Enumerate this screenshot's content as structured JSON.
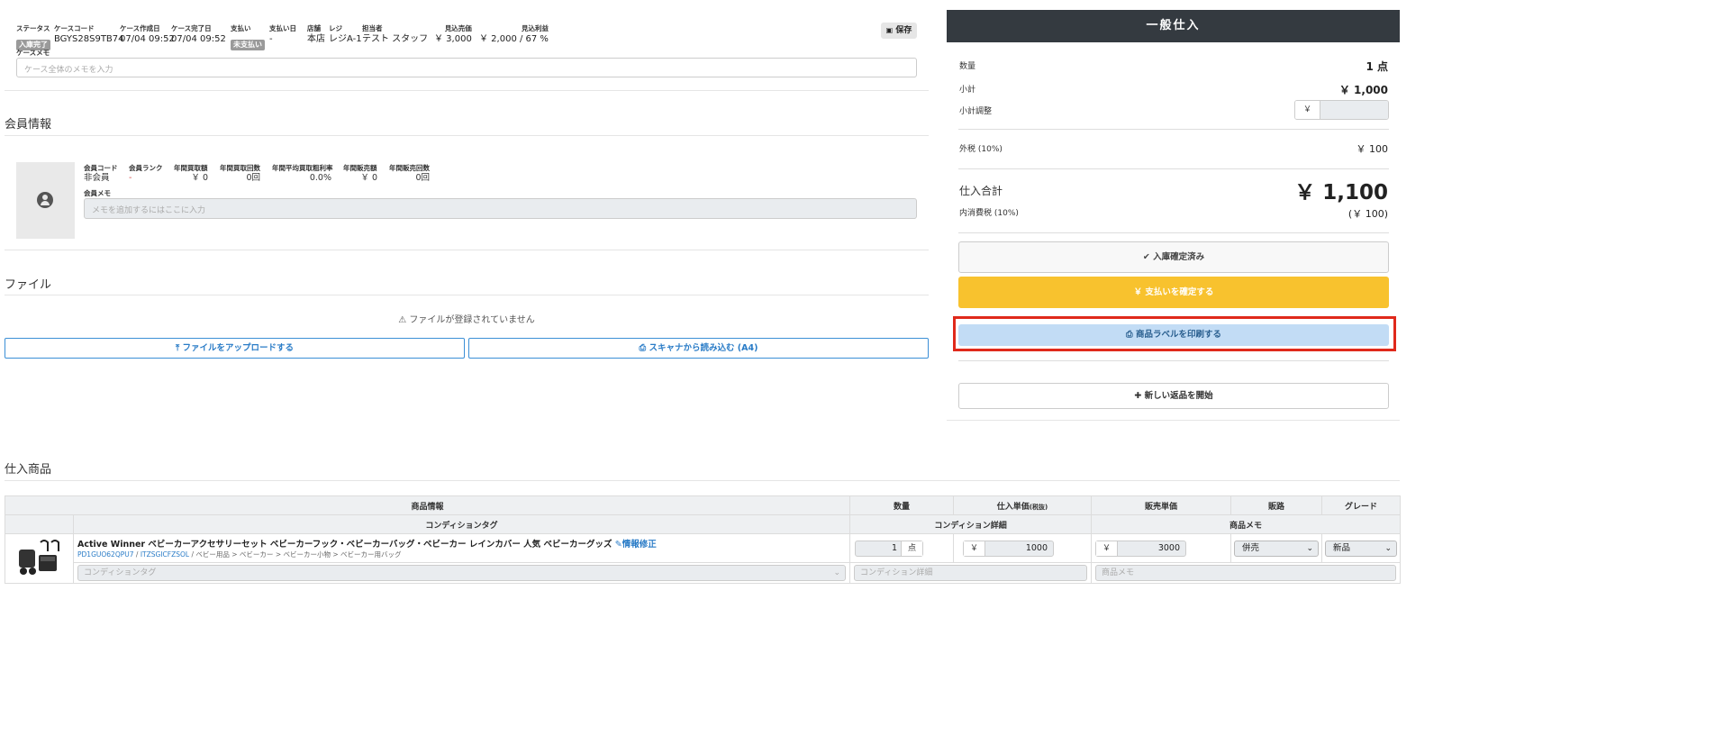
{
  "case": {
    "labels": {
      "status": "ステータス",
      "case_code": "ケースコード",
      "created": "ケース作成日",
      "completed": "ケース完了日",
      "payment": "支払い",
      "payment_date": "支払い日",
      "store": "店舗",
      "register": "レジ",
      "staff": "担当者",
      "expected_sales": "見込売価",
      "expected_profit": "見込利益"
    },
    "values": {
      "status": "入庫完了",
      "case_code": "BGYS28S9TB74",
      "created": "07/04 09:52",
      "completed": "07/04 09:52",
      "payment": "未支払い",
      "payment_date": "-",
      "store": "本店",
      "register": "レジA-1",
      "staff": "テスト スタッフ",
      "expected_sales": "￥ 3,000",
      "expected_profit": "￥ 2,000 / 67 %"
    },
    "save_label": "保存",
    "memo_label": "ケースメモ",
    "memo_placeholder": "ケース全体のメモを入力"
  },
  "member": {
    "section_title": "会員情報",
    "labels": {
      "code": "会員コード",
      "rank": "会員ランク",
      "annual_purchase_amount": "年間買取額",
      "annual_purchase_count": "年間買取回数",
      "avg_margin": "年間平均買取粗利率",
      "annual_sales_amount": "年間販売額",
      "annual_sales_count": "年間販売回数"
    },
    "values": {
      "code": "非会員",
      "rank": "-",
      "annual_purchase_amount": "￥ 0",
      "annual_purchase_count": "0回",
      "avg_margin": "0.0%",
      "annual_sales_amount": "￥ 0",
      "annual_sales_count": "0回"
    },
    "memo_label": "会員メモ",
    "memo_placeholder": "メモを追加するにはここに入力"
  },
  "files": {
    "section_title": "ファイル",
    "empty_message": "ファイルが登録されていません",
    "upload_label": "ファイルをアップロードする",
    "scan_label": "スキャナから読み込む (A4)"
  },
  "summary": {
    "title": "一般仕入",
    "quantity_label": "数量",
    "quantity_value": "1 点",
    "subtotal_label": "小計",
    "subtotal_value": "￥ 1,000",
    "adjust_label": "小計調整",
    "adjust_prefix": "￥",
    "tax_label": "外税 (10%)",
    "tax_value": "￥ 100",
    "total_label": "仕入合計",
    "total_value": "￥ 1,100",
    "inner_tax_label": "内消費税 (10%)",
    "inner_tax_value": "(￥ 100)",
    "confirmed_label": "入庫確定済み",
    "pay_label": "￥ 支払いを確定する",
    "print_label": "商品ラベルを印刷する",
    "return_label": "新しい返品を開始",
    "colors": {
      "header": "#343a40",
      "pay": "#f8c22e",
      "print": "#c2dcf5",
      "highlight": "#e0291b"
    }
  },
  "products": {
    "section_title": "仕入商品",
    "headers": {
      "info": "商品情報",
      "qty": "数量",
      "unit_price": "仕入単価",
      "unit_price_note": "(税抜)",
      "sale_price": "販売単価",
      "channel": "販路",
      "grade": "グレード",
      "condition_tag": "コンディションタグ",
      "condition_detail": "コンディション詳細",
      "product_memo": "商品メモ"
    },
    "rows": [
      {
        "title": "Active Winner ベビーカーアクセサリーセット ベビーカーフック・ベビーカーバッグ・ベビーカー レインカバー 人気 ベビーカーグッズ",
        "edit_label": "情報修正",
        "code1": "PD1GUO62QPU7",
        "code2": "ITZSGICFZSOL",
        "category": " / ベビー用品 > ベビーカー > ベビーカー小物 > ベビーカー用バッグ",
        "qty": "1",
        "qty_unit": "点",
        "cost_prefix": "￥",
        "cost": "1000",
        "price_prefix": "￥",
        "price": "3000",
        "channel": "併売",
        "grade": "新品",
        "condition_tag_placeholder": "コンディションタグ",
        "condition_detail_placeholder": "コンディション詳細",
        "memo_placeholder": "商品メモ"
      }
    ]
  }
}
